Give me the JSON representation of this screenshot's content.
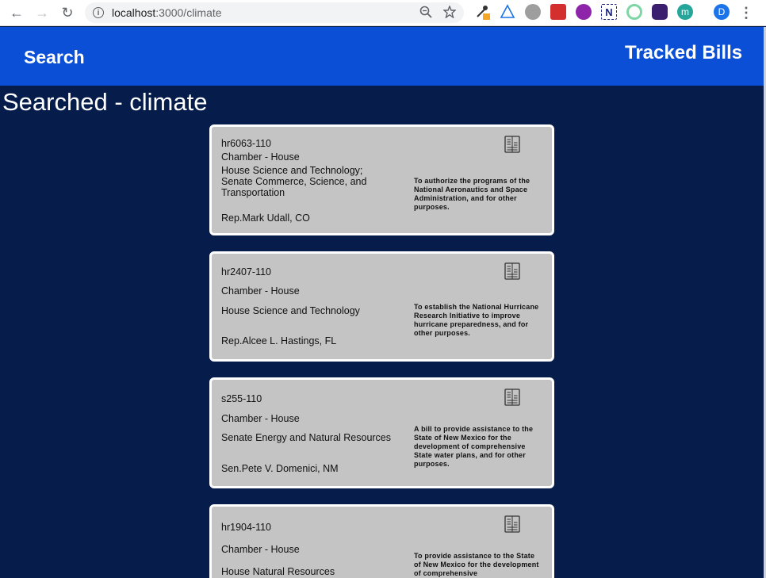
{
  "browser": {
    "url_host": "localhost",
    "url_path": ":3000/climate",
    "profile_initial": "D"
  },
  "header": {
    "search_label": "Search",
    "tracked_label": "Tracked Bills"
  },
  "page_title": "Searched - climate",
  "bills": [
    {
      "id": "hr6063-110",
      "chamber": "Chamber - House",
      "committee": "House Science and Technology; Senate Commerce, Science, and Transportation",
      "sponsor": "Rep.Mark Udall, CO",
      "summary": "To authorize the programs of the National Aeronautics and Space Administration, and for other purposes."
    },
    {
      "id": "hr2407-110",
      "chamber": "Chamber - House",
      "committee": "House Science and Technology",
      "sponsor": "Rep.Alcee L. Hastings, FL",
      "summary": "To establish the National Hurricane Research Initiative to improve hurricane preparedness, and for other purposes."
    },
    {
      "id": "s255-110",
      "chamber": "Chamber - House",
      "committee": "Senate Energy and Natural Resources",
      "sponsor": "Sen.Pete V. Domenici, NM",
      "summary": "A bill to provide assistance to the State of New Mexico for the development of comprehensive State water plans, and for other purposes."
    },
    {
      "id": "hr1904-110",
      "chamber": "Chamber - House",
      "committee": "House Natural Resources",
      "sponsor": "",
      "summary": "To provide assistance to the State of New Mexico for the development of comprehensive"
    }
  ],
  "icons": {
    "card_icon": "document-icon"
  }
}
